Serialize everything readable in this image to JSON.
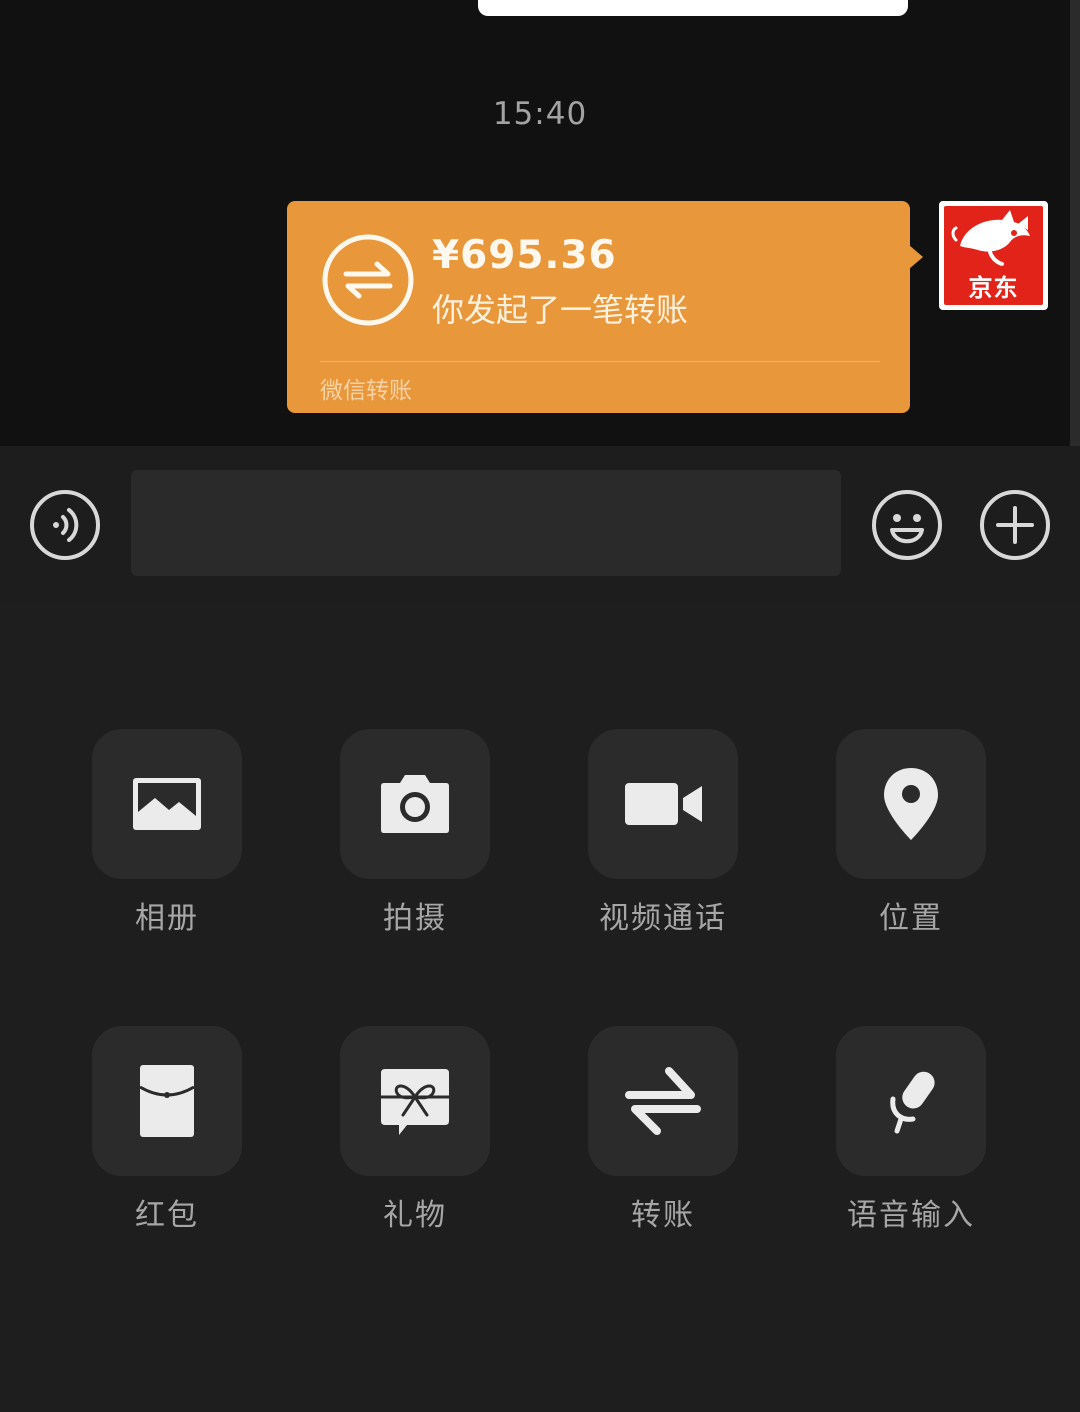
{
  "chat": {
    "timestamp": "15:40",
    "transfer": {
      "amount": "¥695.36",
      "subtitle": "你发起了一笔转账",
      "footer": "微信转账"
    },
    "avatar": {
      "label": "京东"
    }
  },
  "input": {
    "value": "",
    "placeholder": ""
  },
  "panel": {
    "items": [
      {
        "label": "相册",
        "icon": "photo-album-icon"
      },
      {
        "label": "拍摄",
        "icon": "camera-icon"
      },
      {
        "label": "视频通话",
        "icon": "video-call-icon"
      },
      {
        "label": "位置",
        "icon": "location-pin-icon"
      },
      {
        "label": "红包",
        "icon": "red-packet-icon"
      },
      {
        "label": "礼物",
        "icon": "gift-icon"
      },
      {
        "label": "转账",
        "icon": "transfer-icon"
      },
      {
        "label": "语音输入",
        "icon": "microphone-icon"
      }
    ]
  },
  "colors": {
    "transfer_card": "#e8973b",
    "jd_red": "#e2231a",
    "background": "#111111",
    "panel": "#1e1e1e",
    "tile": "#2b2b2b"
  }
}
